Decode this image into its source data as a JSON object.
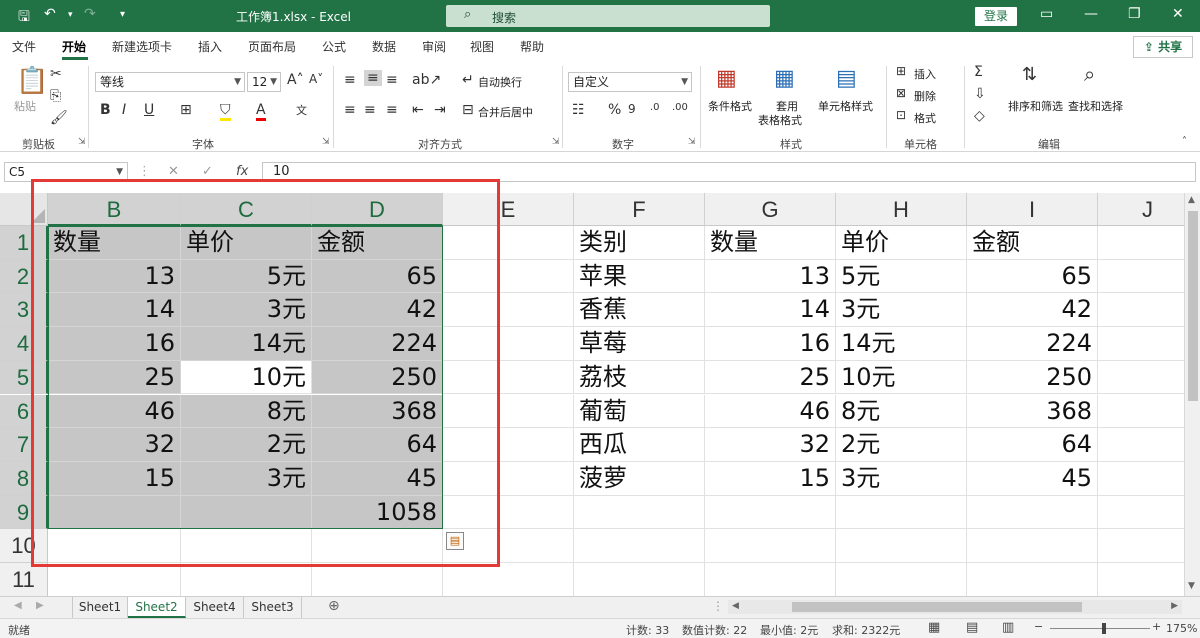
{
  "title_bar": {
    "title": "工作簿1.xlsx  -  Excel",
    "search_placeholder": "搜索",
    "login": "登录"
  },
  "menu": {
    "tabs": [
      "文件",
      "开始",
      "新建选项卡",
      "插入",
      "页面布局",
      "公式",
      "数据",
      "审阅",
      "视图",
      "帮助"
    ],
    "active": "开始",
    "share": "共享"
  },
  "ribbon": {
    "groups": [
      "剪贴板",
      "字体",
      "对齐方式",
      "数字",
      "样式",
      "单元格",
      "编辑"
    ],
    "paste": "粘贴",
    "font_name": "等线",
    "font_size": "12",
    "wrap_text": "自动换行",
    "merge_center": "合并后居中",
    "number_format": "自定义",
    "conditional_format": "条件格式",
    "format_as_table_1": "套用",
    "format_as_table_2": "表格格式",
    "cell_styles": "单元格样式",
    "insert": "插入",
    "delete": "删除",
    "format": "格式",
    "sort_filter": "排序和筛选",
    "find_select": "查找和选择"
  },
  "formula_bar": {
    "name_box": "C5",
    "formula": "10"
  },
  "columns": [
    "B",
    "C",
    "D",
    "E",
    "F",
    "G",
    "H",
    "I",
    "J"
  ],
  "rows": [
    "1",
    "2",
    "3",
    "4",
    "5",
    "6",
    "7",
    "8",
    "9",
    "10",
    "11"
  ],
  "left_table": {
    "headers": [
      "数量",
      "单价",
      "金额"
    ],
    "rows": [
      [
        "13",
        "5元",
        "65"
      ],
      [
        "14",
        "3元",
        "42"
      ],
      [
        "16",
        "14元",
        "224"
      ],
      [
        "25",
        "10元",
        "250"
      ],
      [
        "46",
        "8元",
        "368"
      ],
      [
        "32",
        "2元",
        "64"
      ],
      [
        "15",
        "3元",
        "45"
      ],
      [
        "",
        "",
        "1058"
      ]
    ]
  },
  "right_table": {
    "headers": [
      "类别",
      "数量",
      "单价",
      "金额"
    ],
    "rows": [
      [
        "苹果",
        "13",
        "5元",
        "65"
      ],
      [
        "香蕉",
        "14",
        "3元",
        "42"
      ],
      [
        "草莓",
        "16",
        "14元",
        "224"
      ],
      [
        "荔枝",
        "25",
        "10元",
        "250"
      ],
      [
        "葡萄",
        "46",
        "8元",
        "368"
      ],
      [
        "西瓜",
        "32",
        "2元",
        "64"
      ],
      [
        "菠萝",
        "15",
        "3元",
        "45"
      ]
    ]
  },
  "sheets": [
    "Sheet1",
    "Sheet2",
    "Sheet4",
    "Sheet3"
  ],
  "active_sheet": "Sheet2",
  "status": {
    "ready": "就绪",
    "count": "计数: 33",
    "numeric_count": "数值计数: 22",
    "min": "最小值: 2元",
    "sum": "求和: 2322元",
    "zoom": "175%"
  },
  "colors": {
    "accent": "#217346",
    "highlight_box": "#e53935",
    "selection": "#c6c6c6"
  }
}
